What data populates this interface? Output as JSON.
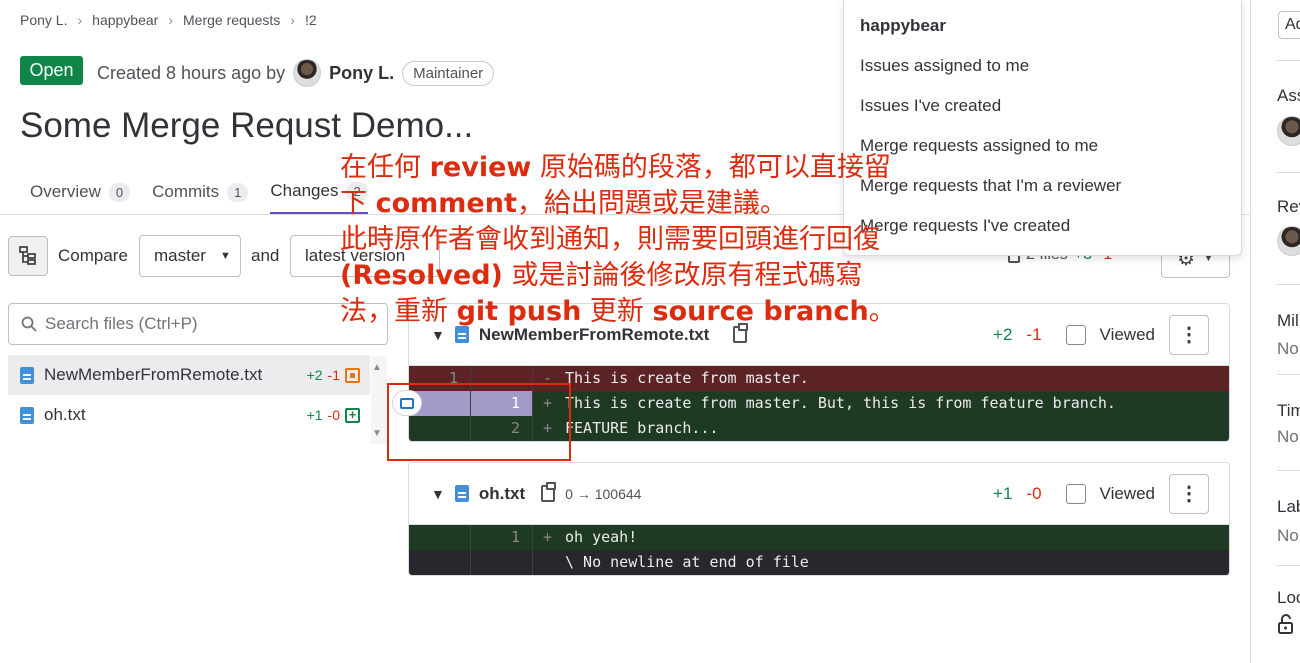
{
  "breadcrumb": [
    "Pony L.",
    "happybear",
    "Merge requests",
    "!2"
  ],
  "header": {
    "status": "Open",
    "created_prefix": "Created 8 hours ago by",
    "author": "Pony L.",
    "role": "Maintainer",
    "title": "Some Merge Requst Demo..."
  },
  "tabs": [
    {
      "label": "Overview",
      "count": "0"
    },
    {
      "label": "Commits",
      "count": "1"
    },
    {
      "label": "Changes",
      "count": "2"
    }
  ],
  "compare": {
    "label": "Compare",
    "source": "master",
    "and": "and",
    "target": "latest version",
    "files_count": "2 files",
    "added": "+3",
    "removed": "-1"
  },
  "file_tree": {
    "search_placeholder": "Search files (Ctrl+P)",
    "files": [
      {
        "name": "NewMemberFromRemote.txt",
        "added": "+2",
        "removed": "-1",
        "status": "modified"
      },
      {
        "name": "oh.txt",
        "added": "+1",
        "removed": "-0",
        "status": "added"
      }
    ]
  },
  "diffs": [
    {
      "name": "NewMemberFromRemote.txt",
      "mode": "",
      "added": "+2",
      "removed": "-1",
      "viewed_label": "Viewed",
      "lines": [
        {
          "type": "old",
          "old_ln": "1",
          "new_ln": "",
          "sign": "-",
          "text": "This is create from master."
        },
        {
          "type": "new",
          "old_ln": "",
          "new_ln": "1",
          "sign": "+",
          "text": "This is create from master. But, this is from feature branch."
        },
        {
          "type": "new",
          "old_ln": "",
          "new_ln": "2",
          "sign": "+",
          "text": "FEATURE branch..."
        }
      ]
    },
    {
      "name": "oh.txt",
      "mode": "0 → 100644",
      "added": "+1",
      "removed": "-0",
      "viewed_label": "Viewed",
      "lines": [
        {
          "type": "new",
          "old_ln": "",
          "new_ln": "1",
          "sign": "+",
          "text": "oh yeah!"
        },
        {
          "type": "ctx",
          "old_ln": "",
          "new_ln": "",
          "sign": "",
          "text": "\\ No newline at end of file"
        }
      ]
    }
  ],
  "menu": {
    "title": "happybear",
    "items": [
      "Issues assigned to me",
      "Issues I've created",
      "Merge requests assigned to me",
      "Merge requests that I'm a reviewer",
      "Merge requests I've created"
    ]
  },
  "sidebar": {
    "button": "Ad",
    "sections": [
      {
        "label": "Ass",
        "value": ""
      },
      {
        "label": "Rev",
        "value": ""
      },
      {
        "label": "Mil",
        "value": "No"
      },
      {
        "label": "Tim",
        "value": "No"
      },
      {
        "label": "Lab",
        "value": "No"
      },
      {
        "label": "Loc",
        "value": ""
      }
    ]
  },
  "annotation": {
    "l1a": "在任何 ",
    "l1b": "review",
    "l1c": " 原始碼的段落，都可以直接留",
    "l2a": "下 ",
    "l2b": "comment",
    "l2c": "，給出問題或是建議。",
    "l3": "此時原作者會收到通知，則需要回頭進行回復",
    "l4a": "(Resolved)",
    "l4b": " 或是討論後修改原有程式碼寫",
    "l5a": "法，重新 ",
    "l5b": "git push",
    "l5c": " 更新 ",
    "l5d": "source branch",
    "l5e": "。"
  },
  "colors": {
    "open_badge": "#108548",
    "accent": "#6b4fbb",
    "added": "#108548",
    "removed": "#dd2b0e",
    "annotation": "#dd2b0e"
  }
}
